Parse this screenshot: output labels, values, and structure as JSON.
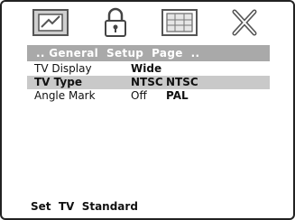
{
  "icons": [
    {
      "name": "general-setup-icon"
    },
    {
      "name": "lock-icon"
    },
    {
      "name": "preference-icon"
    },
    {
      "name": "exit-icon"
    }
  ],
  "header": {
    "title": ".. General  Setup  Page  .."
  },
  "menu": {
    "items": [
      {
        "label": "TV Display",
        "value": "Wide",
        "option": ""
      },
      {
        "label": "TV Type",
        "value": "NTSC",
        "option": "NTSC"
      },
      {
        "label": "Angle Mark",
        "value": "Off",
        "option": "PAL"
      }
    ]
  },
  "footer": {
    "text": "Set  TV  Standard"
  },
  "colors": {
    "header_bg": "#a9a9a9",
    "selected_bg": "#c9c9c9"
  }
}
